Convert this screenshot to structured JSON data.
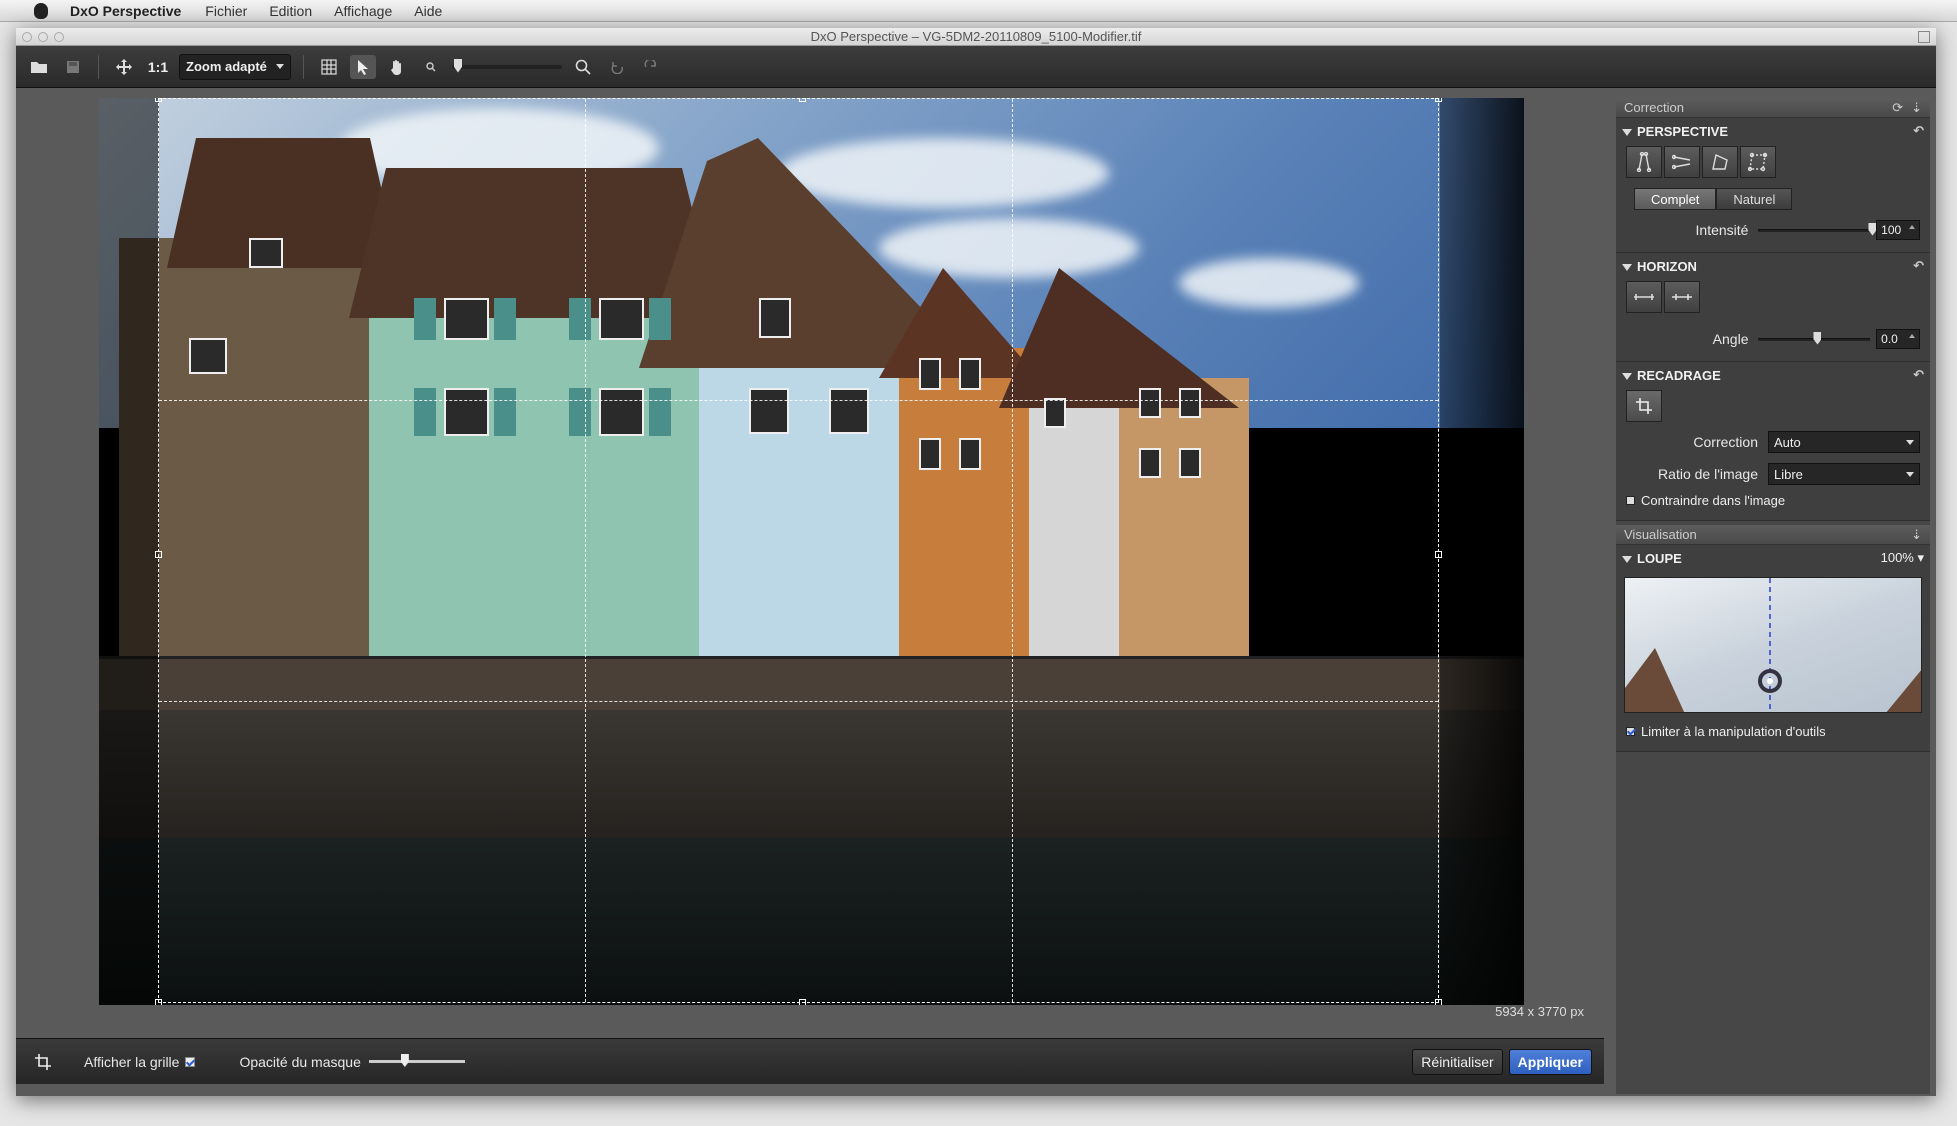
{
  "menubar": {
    "app": "DxO Perspective",
    "items": [
      "Fichier",
      "Edition",
      "Affichage",
      "Aide"
    ]
  },
  "window": {
    "title": "DxO Perspective – VG-5DM2-20110809_5100-Modifier.tif"
  },
  "toolbar": {
    "one_to_one": "1:1",
    "zoom_mode": "Zoom adapté"
  },
  "canvas": {
    "dimensions": "5934 x 3770 px"
  },
  "bottombar": {
    "grid_label": "Afficher la grille",
    "grid_checked": true,
    "mask_opacity_label": "Opacité du masque",
    "reset": "Réinitialiser",
    "apply": "Appliquer"
  },
  "panel": {
    "correction_header": "Correction",
    "perspective": {
      "title": "PERSPECTIVE",
      "mode_full": "Complet",
      "mode_natural": "Naturel",
      "selected_mode": "Complet",
      "intensity_label": "Intensité",
      "intensity_value": "100",
      "intensity_fraction": 1.0
    },
    "horizon": {
      "title": "HORIZON",
      "angle_label": "Angle",
      "angle_value": "0.0",
      "angle_fraction": 0.5
    },
    "crop": {
      "title": "RECADRAGE",
      "correction_label": "Correction",
      "correction_value": "Auto",
      "ratio_label": "Ratio de l'image",
      "ratio_value": "Libre",
      "constrain_label": "Contraindre dans l'image",
      "constrain_checked": false
    },
    "visualisation_header": "Visualisation",
    "loupe": {
      "title": "LOUPE",
      "zoom": "100%",
      "limit_label": "Limiter à la manipulation d'outils",
      "limit_checked": true
    }
  }
}
